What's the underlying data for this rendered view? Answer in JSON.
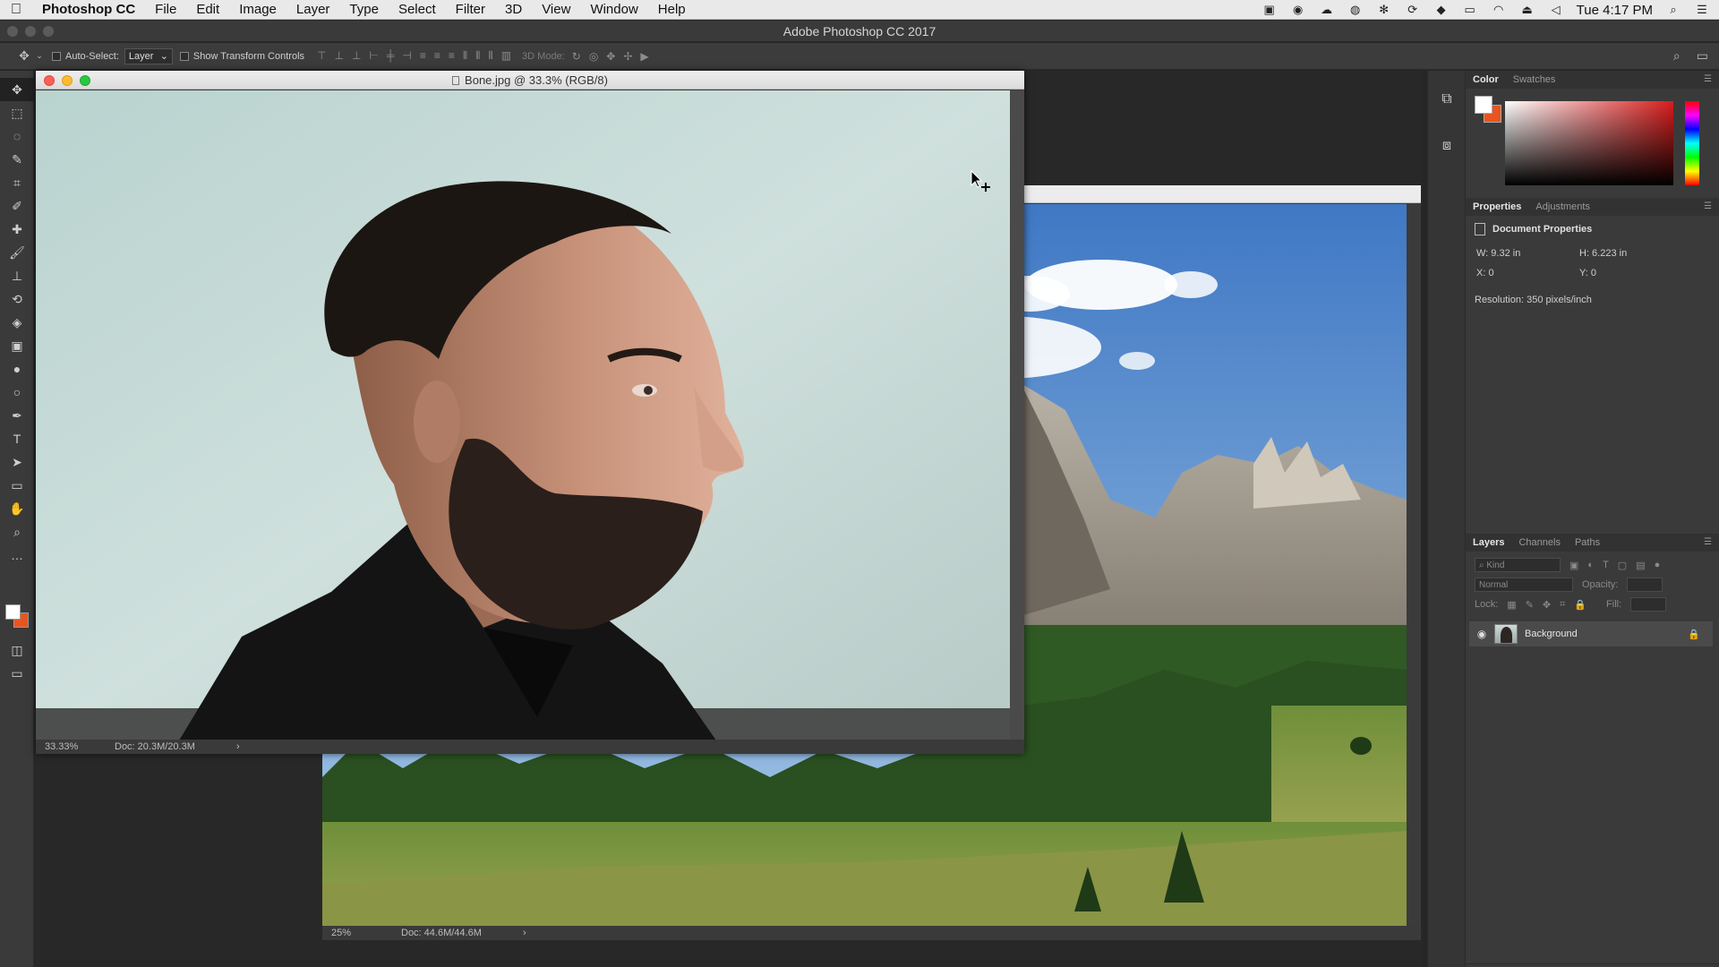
{
  "menubar": {
    "app_name": "Photoshop CC",
    "items": [
      "File",
      "Edit",
      "Image",
      "Layer",
      "Type",
      "Select",
      "Filter",
      "3D",
      "View",
      "Window",
      "Help"
    ],
    "clock": "Tue 4:17 PM",
    "icons": [
      "screen-icon",
      "record-icon",
      "cloud-icon",
      "globe-icon",
      "settings-icon",
      "sync-icon",
      "dropbox-icon",
      "display-icon",
      "wifi-icon",
      "eject-icon",
      "volume-icon",
      "search-icon",
      "list-icon"
    ]
  },
  "app": {
    "title": "Adobe Photoshop CC 2017"
  },
  "options": {
    "auto_select_label": "Auto-Select:",
    "auto_select_value": "Layer",
    "transform_label": "Show Transform Controls",
    "mode_3d_label": "3D Mode:"
  },
  "tools": {
    "items": [
      "move-tool",
      "marquee-tool",
      "lasso-tool",
      "quick-select-tool",
      "crop-tool",
      "eyedropper-tool",
      "healing-tool",
      "brush-tool",
      "stamp-tool",
      "history-brush-tool",
      "eraser-tool",
      "gradient-tool",
      "blur-tool",
      "dodge-tool",
      "pen-tool",
      "type-tool",
      "path-select-tool",
      "rectangle-tool",
      "hand-tool",
      "zoom-tool",
      "more-tools"
    ],
    "glyphs": [
      "✥",
      "⬚",
      "◌",
      "✎",
      "⌗",
      "✐",
      "✚",
      "🖌",
      "⊥",
      "⟲",
      "◈",
      "▣",
      "●",
      "○",
      "✒",
      "T",
      "➤",
      "▭",
      "✋",
      "⌕",
      "…"
    ],
    "foreground_color": "#ffffff",
    "background_color": "#e8551f"
  },
  "documents": {
    "portrait": {
      "title": "Bone.jpg @ 33.3% (RGB/8)",
      "zoom": "33.33%",
      "doc_size": "Doc: 20.3M/20.3M"
    },
    "landscape": {
      "zoom": "25%",
      "doc_size": "Doc: 44.6M/44.6M"
    }
  },
  "panels": {
    "color_tabs": [
      "Color",
      "Swatches"
    ],
    "properties_tabs": [
      "Properties",
      "Adjustments"
    ],
    "properties": {
      "heading": "Document Properties",
      "w": "W: 9.32 in",
      "h": "H: 6.223 in",
      "x": "X: 0",
      "y": "Y: 0",
      "resolution": "Resolution: 350 pixels/inch"
    },
    "layers_tabs": [
      "Layers",
      "Channels",
      "Paths"
    ],
    "layers": {
      "kind_placeholder": "Kind",
      "blend_mode": "Normal",
      "opacity_label": "Opacity:",
      "lock_label": "Lock:",
      "fill_label": "Fill:",
      "items": [
        {
          "name": "Background",
          "visible": true,
          "locked": true
        }
      ]
    }
  },
  "colors": {
    "accent_orange": "#e8551f",
    "panel_bg": "#3a3a3a",
    "canvas_bg": "#282828"
  }
}
